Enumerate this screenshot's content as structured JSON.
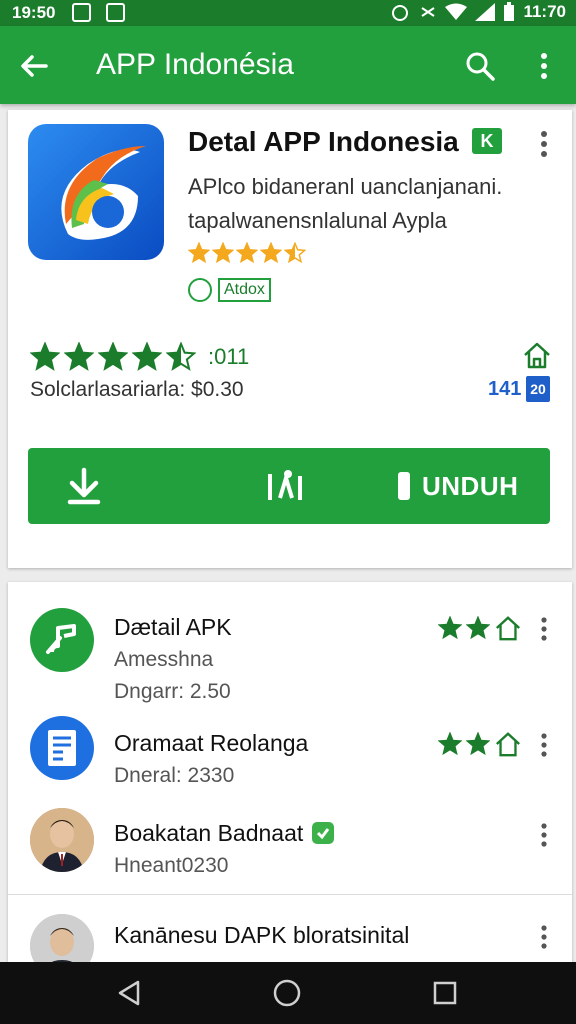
{
  "status_bar": {
    "time_left": "19:50",
    "time_right": "11:70"
  },
  "app_bar": {
    "title": "APP Indonésia"
  },
  "detail": {
    "title": "Detal APP Indonesia",
    "verified_badge": "K",
    "desc_line1": "APlco bidaneranl uanclanjanani.",
    "desc_line2": "tapalwanensnlalunal Aypla",
    "small_rating": 4.5,
    "tag_label": "Atdox",
    "big_rating": 4.5,
    "rating_count": ":011",
    "size_label": "Solclarlasariarla: $0.30",
    "size_count": "141",
    "size_badge": "20",
    "download_button": "UNDUH",
    "colors": {
      "primary": "#23a03e",
      "primary_dark": "#1b7d2c",
      "star": "#f4a81d",
      "accent_blue": "#1f5fc9"
    }
  },
  "list": [
    {
      "title": "Dætail APK",
      "subtitle": "Amesshna",
      "meta": "Dngarr: 2.50",
      "stars": 2,
      "icon": "music-note-icon"
    },
    {
      "title": "Oramaat Reolanga",
      "subtitle": "",
      "meta": "Dneral: 2330",
      "stars": 2,
      "icon": "document-icon"
    },
    {
      "title": "Boakatan Badnaat",
      "subtitle": "",
      "meta": "Hneant0230",
      "stars": 0,
      "icon": "person-avatar"
    },
    {
      "title": "Kanānesu DAPK bloratsinital",
      "subtitle": "",
      "meta": "",
      "stars": 0,
      "icon": "person-avatar"
    }
  ]
}
